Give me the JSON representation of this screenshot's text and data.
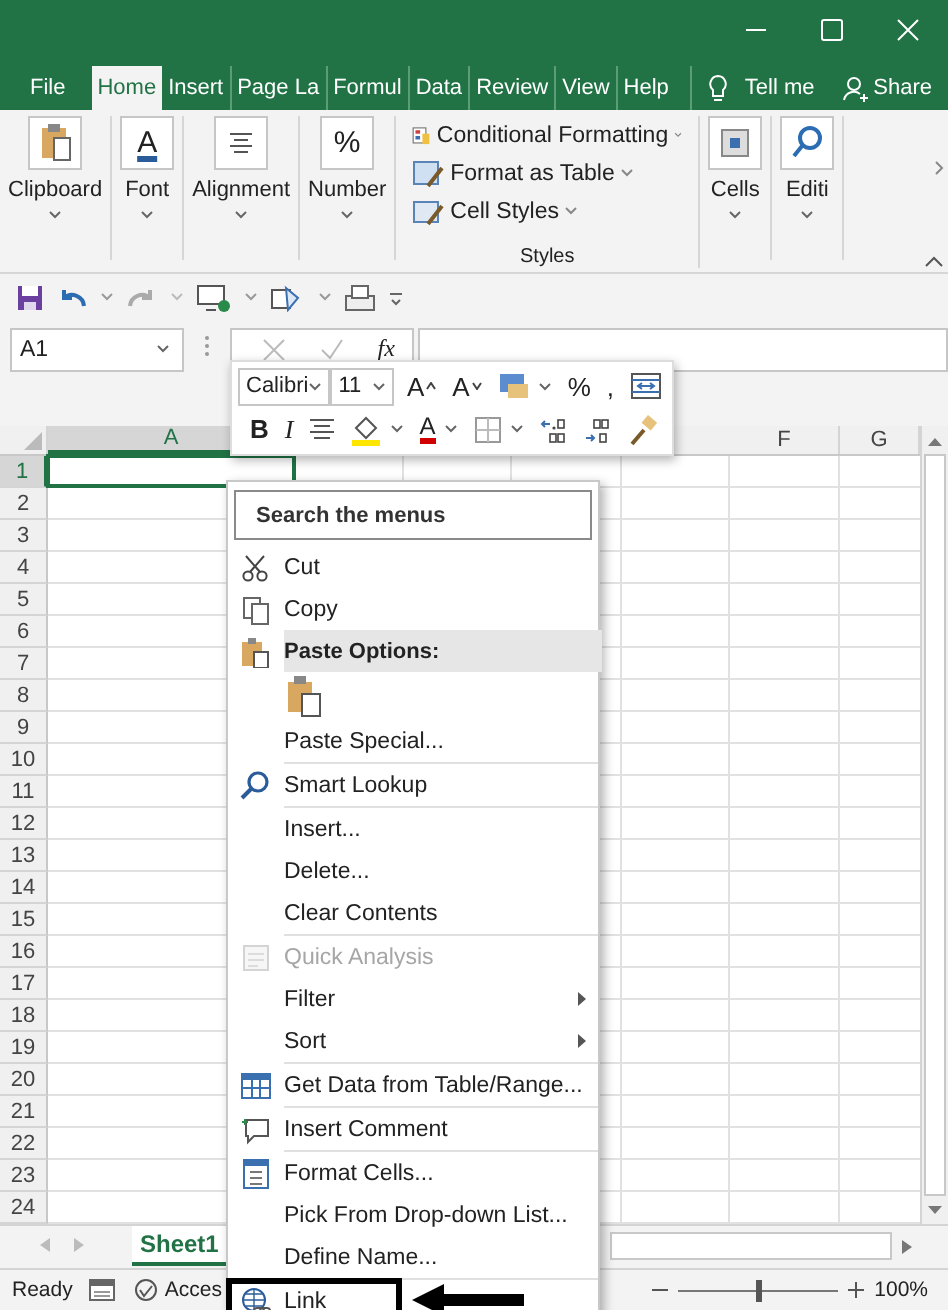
{
  "tabs": [
    {
      "label": "File",
      "selected": false
    },
    {
      "label": "Home",
      "selected": true
    },
    {
      "label": "Insert",
      "selected": false
    },
    {
      "label": "Page La",
      "selected": false
    },
    {
      "label": "Formul",
      "selected": false
    },
    {
      "label": "Data",
      "selected": false
    },
    {
      "label": "Review",
      "selected": false
    },
    {
      "label": "View",
      "selected": false
    },
    {
      "label": "Help",
      "selected": false
    }
  ],
  "tell_me": "Tell me",
  "share": "Share",
  "ribbon": {
    "groups": [
      {
        "kind": "big",
        "label": "Clipboard"
      },
      {
        "kind": "big",
        "label": "Font",
        "glyph": "A"
      },
      {
        "kind": "big",
        "label": "Alignment"
      },
      {
        "kind": "big",
        "label": "Number",
        "glyph": "%"
      },
      {
        "kind": "styles",
        "label": "Styles",
        "items": [
          "Conditional Formatting",
          "Format as Table",
          "Cell Styles"
        ]
      },
      {
        "kind": "big",
        "label": "Cells"
      },
      {
        "kind": "big",
        "label": "Editi"
      }
    ]
  },
  "name_box": {
    "value": "A1"
  },
  "formula_bar": {
    "function_label": "fx"
  },
  "grid": {
    "column_headers": [
      "A",
      "F",
      "G"
    ],
    "rows": [
      {
        "number": "1",
        "selected": true
      },
      {
        "number": "2",
        "selected": false
      },
      {
        "number": "3",
        "selected": false
      },
      {
        "number": "4",
        "selected": false
      },
      {
        "number": "5",
        "selected": false
      },
      {
        "number": "6",
        "selected": false
      },
      {
        "number": "7",
        "selected": false
      },
      {
        "number": "8",
        "selected": false
      },
      {
        "number": "9",
        "selected": false
      },
      {
        "number": "10",
        "selected": false
      },
      {
        "number": "11",
        "selected": false
      },
      {
        "number": "12",
        "selected": false
      },
      {
        "number": "13",
        "selected": false
      },
      {
        "number": "14",
        "selected": false
      },
      {
        "number": "15",
        "selected": false
      },
      {
        "number": "16",
        "selected": false
      },
      {
        "number": "17",
        "selected": false
      },
      {
        "number": "18",
        "selected": false
      },
      {
        "number": "19",
        "selected": false
      },
      {
        "number": "20",
        "selected": false
      },
      {
        "number": "21",
        "selected": false
      },
      {
        "number": "22",
        "selected": false
      },
      {
        "number": "23",
        "selected": false
      },
      {
        "number": "24",
        "selected": false
      }
    ]
  },
  "sheet_tabs": [
    {
      "label": "Sheet1",
      "selected": true
    }
  ],
  "status_bar": {
    "mode": "Ready",
    "accessibility": "Acces",
    "zoom": {
      "level": 0.5,
      "reading": "100%"
    }
  },
  "mini_toolbar": {
    "font": "Calibri",
    "size": "11",
    "row1": [
      {
        "kind": "font-grow",
        "label": "A",
        "dropdown": false
      },
      {
        "kind": "font-shrink",
        "label": "A",
        "dropdown": false
      },
      {
        "kind": "number-format",
        "dropdown": true
      },
      {
        "kind": "text",
        "label": "%",
        "dropdown": false
      },
      {
        "kind": "text",
        "label": ",",
        "dropdown": false
      },
      {
        "kind": "wrap",
        "dropdown": false
      }
    ],
    "row2": [
      {
        "kind": "bold",
        "label": "B",
        "dropdown": false
      },
      {
        "kind": "italic",
        "label": "I",
        "dropdown": false
      },
      {
        "kind": "align",
        "dropdown": false
      },
      {
        "kind": "fill",
        "dropdown": true
      },
      {
        "kind": "font-color",
        "label": "A",
        "dropdown": true
      },
      {
        "kind": "borders",
        "dropdown": true
      },
      {
        "kind": "inc-decimal",
        "dropdown": false
      },
      {
        "kind": "dec-decimal",
        "dropdown": false
      },
      {
        "kind": "painter",
        "dropdown": false
      }
    ]
  },
  "context_menu": {
    "search": {
      "placeholder": "Search the menus"
    },
    "groups": [
      [
        {
          "kind": "item",
          "label": "Cut",
          "disabled": false,
          "submenu": false,
          "highlighted": false
        },
        {
          "kind": "item",
          "label": "Copy",
          "disabled": false,
          "submenu": false,
          "highlighted": false
        },
        {
          "kind": "header",
          "label": "Paste Options:"
        },
        {
          "kind": "paste-icons"
        },
        {
          "kind": "item",
          "label": "Paste Special...",
          "disabled": false,
          "submenu": false,
          "highlighted": false
        }
      ],
      [
        {
          "kind": "item",
          "label": "Smart Lookup",
          "disabled": false,
          "submenu": false,
          "highlighted": false
        }
      ],
      [
        {
          "kind": "item",
          "label": "Insert...",
          "disabled": false,
          "submenu": false,
          "highlighted": false
        },
        {
          "kind": "item",
          "label": "Delete...",
          "disabled": false,
          "submenu": false,
          "highlighted": false
        },
        {
          "kind": "item",
          "label": "Clear Contents",
          "disabled": false,
          "submenu": false,
          "highlighted": false
        }
      ],
      [
        {
          "kind": "item",
          "label": "Quick Analysis",
          "disabled": true,
          "submenu": false,
          "highlighted": false
        },
        {
          "kind": "item",
          "label": "Filter",
          "disabled": false,
          "submenu": true,
          "highlighted": false
        },
        {
          "kind": "item",
          "label": "Sort",
          "disabled": false,
          "submenu": true,
          "highlighted": false
        }
      ],
      [
        {
          "kind": "item",
          "label": "Get Data from Table/Range...",
          "disabled": false,
          "submenu": false,
          "highlighted": false
        }
      ],
      [
        {
          "kind": "item",
          "label": "Insert Comment",
          "disabled": false,
          "submenu": false,
          "highlighted": false
        }
      ],
      [
        {
          "kind": "item",
          "label": "Format Cells...",
          "disabled": false,
          "submenu": false,
          "highlighted": false
        },
        {
          "kind": "item",
          "label": "Pick From Drop-down List...",
          "disabled": false,
          "submenu": false,
          "highlighted": false
        },
        {
          "kind": "item",
          "label": "Define Name...",
          "disabled": false,
          "submenu": false,
          "highlighted": false
        }
      ],
      [
        {
          "kind": "item",
          "label": "Link",
          "disabled": false,
          "submenu": false,
          "highlighted": true
        }
      ]
    ]
  }
}
